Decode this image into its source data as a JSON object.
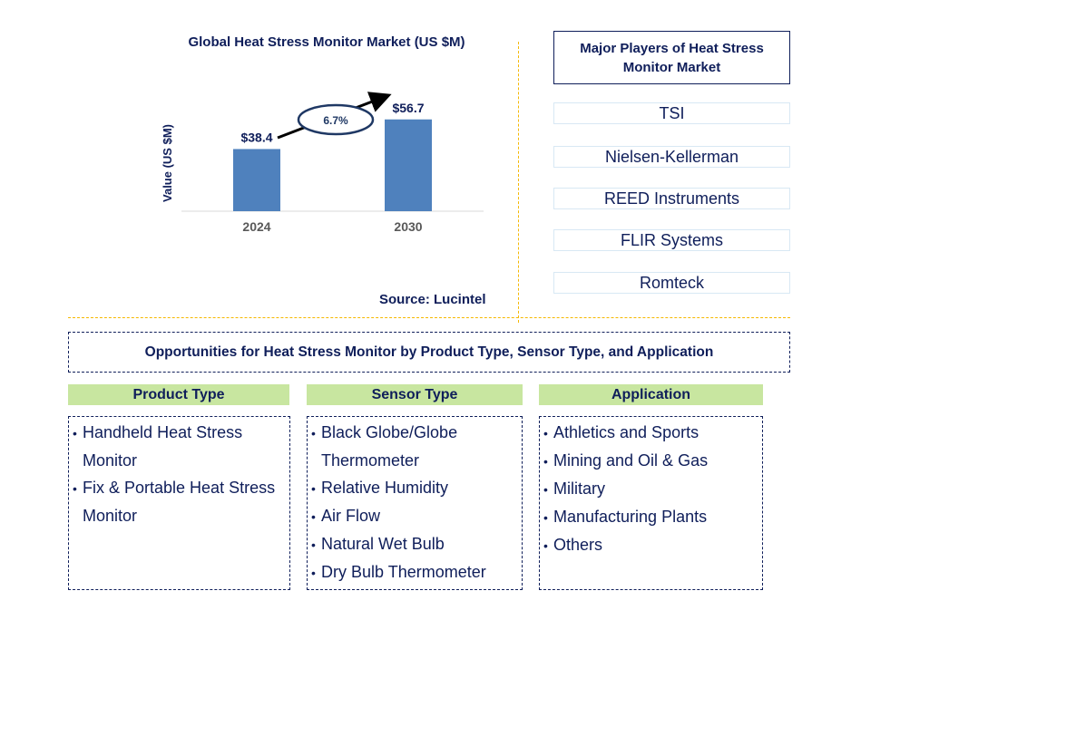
{
  "chart_data": {
    "type": "bar",
    "title": "Global Heat Stress Monitor Market (US $M)",
    "categories": [
      "2024",
      "2030"
    ],
    "values": [
      38.4,
      56.7
    ],
    "value_labels": [
      "$38.4",
      "$56.7"
    ],
    "xlabel": "",
    "ylabel": "Value (US $M)",
    "ylim": [
      0,
      70
    ],
    "grid": false,
    "annotation": {
      "text": "6.7%",
      "meaning": "CAGR 2024-2030"
    },
    "bar_color": "#4f81bd",
    "source": "Source: Lucintel"
  },
  "players": {
    "title": "Major Players of Heat Stress Monitor Market",
    "items": [
      "TSI",
      "Nielsen-Kellerman",
      "REED Instruments",
      "FLIR Systems",
      "Romteck"
    ]
  },
  "opportunities": {
    "title": "Opportunities for Heat Stress Monitor by Product Type, Sensor Type, and Application",
    "categories": [
      {
        "label": "Product Type",
        "items": [
          "Handheld Heat Stress Monitor",
          "Fix & Portable Heat Stress Monitor"
        ]
      },
      {
        "label": "Sensor Type",
        "items": [
          "Black Globe/Globe Thermometer",
          "Relative Humidity",
          "Air Flow",
          "Natural Wet Bulb",
          "Dry Bulb Thermometer"
        ]
      },
      {
        "label": "Application",
        "items": [
          "Athletics and Sports",
          "Mining and Oil & Gas",
          "Military",
          "Manufacturing Plants",
          "Others"
        ]
      }
    ]
  },
  "colors": {
    "text": "#0f1e5a",
    "bar": "#4f81bd",
    "divider": "#f5b800",
    "category_header": "#c8e6a0"
  }
}
